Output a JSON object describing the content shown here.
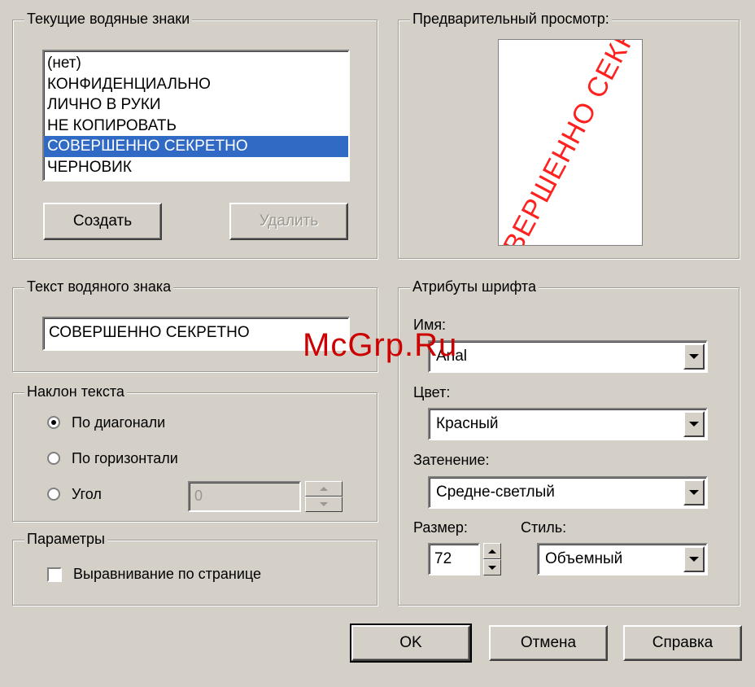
{
  "current_watermarks": {
    "legend": "Текущие водяные знаки",
    "items": [
      "(нет)",
      "КОНФИДЕНЦИАЛЬНО",
      "ЛИЧНО В РУКИ",
      "НЕ КОПИРОВАТЬ",
      "СОВЕРШЕННО СЕКРЕТНО",
      "ЧЕРНОВИК"
    ],
    "selected_index": 4,
    "create_label": "Создать",
    "delete_label": "Удалить"
  },
  "preview": {
    "legend": "Предварительный просмотр:",
    "watermark_text": "ВЕРШЕННО СЕКРЕ"
  },
  "watermark_text": {
    "legend": "Текст водяного знака",
    "value": "СОВЕРШЕННО СЕКРЕТНО"
  },
  "text_angle": {
    "legend": "Наклон текста",
    "diagonal_label": "По диагонали",
    "horizontal_label": "По горизонтали",
    "angle_label": "Угол",
    "angle_value": "0",
    "selected": "diagonal"
  },
  "parameters": {
    "legend": "Параметры",
    "align_label": "Выравнивание по странице",
    "align_checked": false
  },
  "font_attributes": {
    "legend": "Атрибуты шрифта",
    "name_label": "Имя:",
    "name_value": "Arial",
    "color_label": "Цвет:",
    "color_value": "Красный",
    "shading_label": "Затенение:",
    "shading_value": "Средне-светлый",
    "size_label": "Размер:",
    "size_value": "72",
    "style_label": "Стиль:",
    "style_value": "Объемный"
  },
  "buttons": {
    "ok": "OK",
    "cancel": "Отмена",
    "help": "Справка"
  },
  "overlay": {
    "brand": "McGrp.Ru"
  },
  "colors": {
    "dialog_bg": "#d4d0c8",
    "selection": "#316ac5",
    "watermark_red": "#ff2020",
    "brand_red": "#cc0000"
  }
}
